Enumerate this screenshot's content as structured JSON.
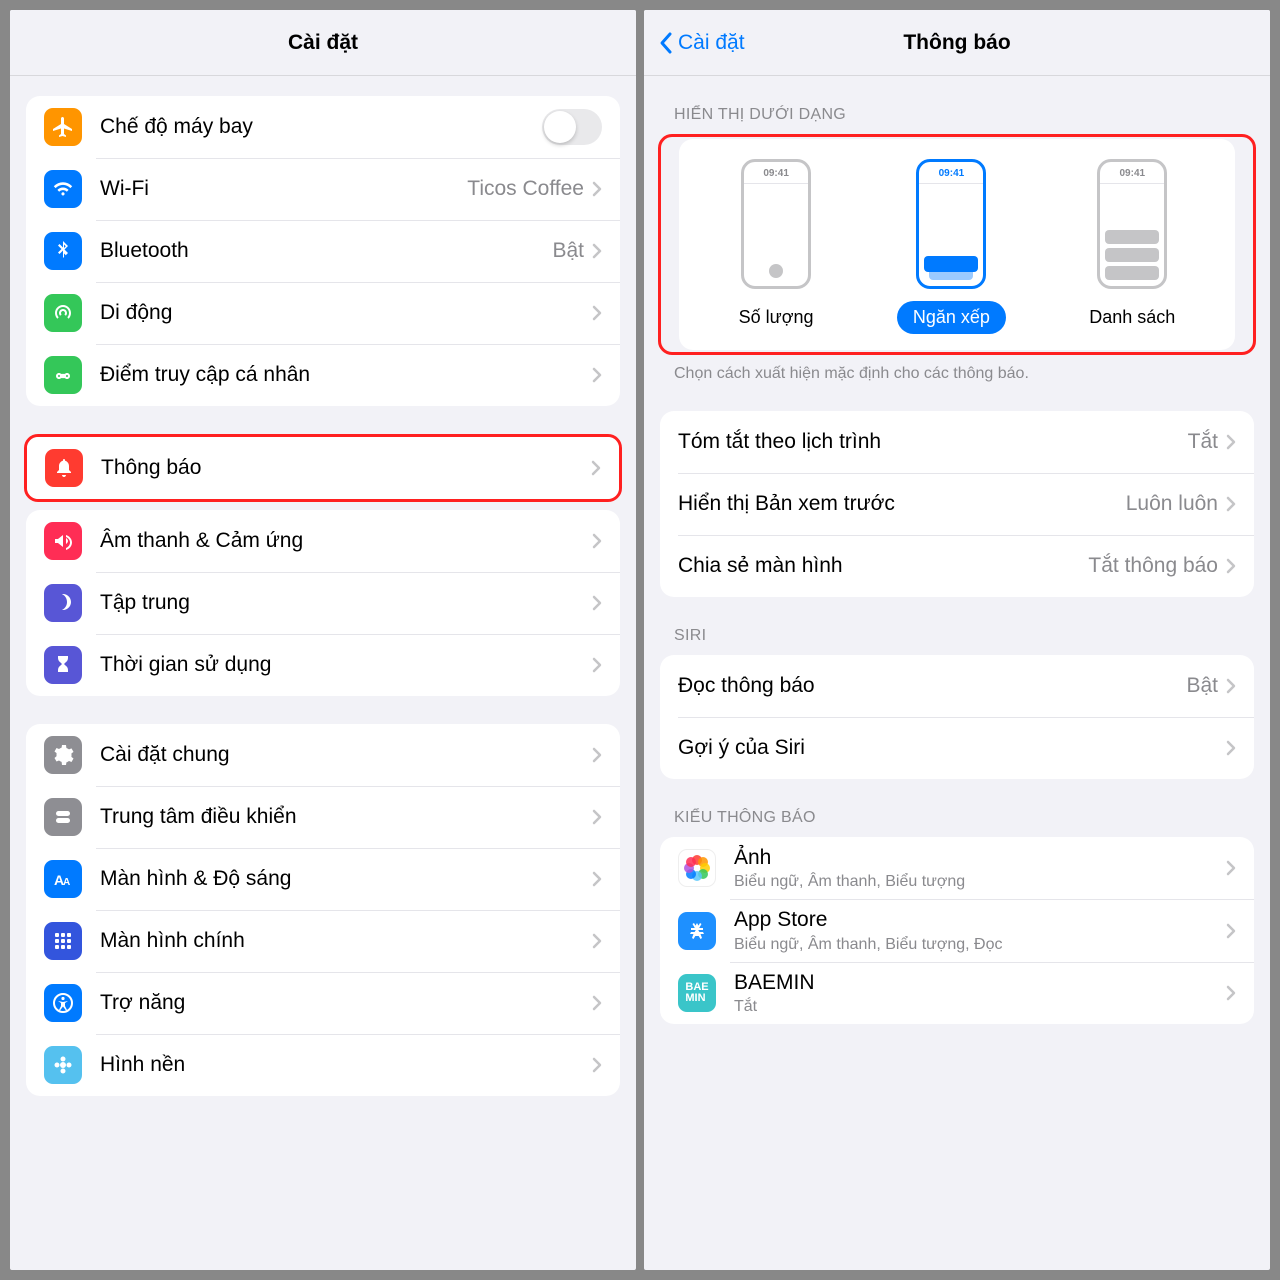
{
  "left": {
    "title": "Cài đặt",
    "g1": [
      {
        "id": "airplane",
        "label": "Chế độ máy bay",
        "toggle": true
      },
      {
        "id": "wifi",
        "label": "Wi-Fi",
        "value": "Ticos Coffee"
      },
      {
        "id": "bluetooth",
        "label": "Bluetooth",
        "value": "Bật"
      },
      {
        "id": "cellular",
        "label": "Di động"
      },
      {
        "id": "hotspot",
        "label": "Điểm truy cập cá nhân"
      }
    ],
    "g2": [
      {
        "id": "notifications",
        "label": "Thông báo",
        "hl": true
      },
      {
        "id": "sounds",
        "label": "Âm thanh & Cảm ứng"
      },
      {
        "id": "focus",
        "label": "Tập trung"
      },
      {
        "id": "screentime",
        "label": "Thời gian sử dụng"
      }
    ],
    "g3": [
      {
        "id": "general",
        "label": "Cài đặt chung"
      },
      {
        "id": "control-center",
        "label": "Trung tâm điều khiển"
      },
      {
        "id": "display",
        "label": "Màn hình & Độ sáng"
      },
      {
        "id": "home",
        "label": "Màn hình chính"
      },
      {
        "id": "accessibility",
        "label": "Trợ năng"
      },
      {
        "id": "wallpaper",
        "label": "Hình nền"
      }
    ]
  },
  "right": {
    "back": "Cài đặt",
    "title": "Thông báo",
    "sec_display": "HIỂN THỊ DƯỚI DẠNG",
    "display_time": "09:41",
    "display_opts": [
      "Số lượng",
      "Ngăn xếp",
      "Danh sách"
    ],
    "display_footer": "Chọn cách xuất hiện mặc định cho các thông báo.",
    "g1": [
      {
        "label": "Tóm tắt theo lịch trình",
        "value": "Tắt"
      },
      {
        "label": "Hiển thị Bản xem trước",
        "value": "Luôn luôn"
      },
      {
        "label": "Chia sẻ màn hình",
        "value": "Tắt thông báo"
      }
    ],
    "sec_siri": "SIRI",
    "g2": [
      {
        "label": "Đọc thông báo",
        "value": "Bật"
      },
      {
        "label": "Gợi ý của Siri"
      }
    ],
    "sec_style": "KIỂU THÔNG BÁO",
    "apps": [
      {
        "id": "photos",
        "title": "Ảnh",
        "sub": "Biểu ngữ, Âm thanh, Biểu tượng"
      },
      {
        "id": "appstore",
        "title": "App Store",
        "sub": "Biểu ngữ, Âm thanh, Biểu tượng, Đọc"
      },
      {
        "id": "baemin",
        "title": "BAEMIN",
        "sub": "Tắt"
      }
    ]
  }
}
